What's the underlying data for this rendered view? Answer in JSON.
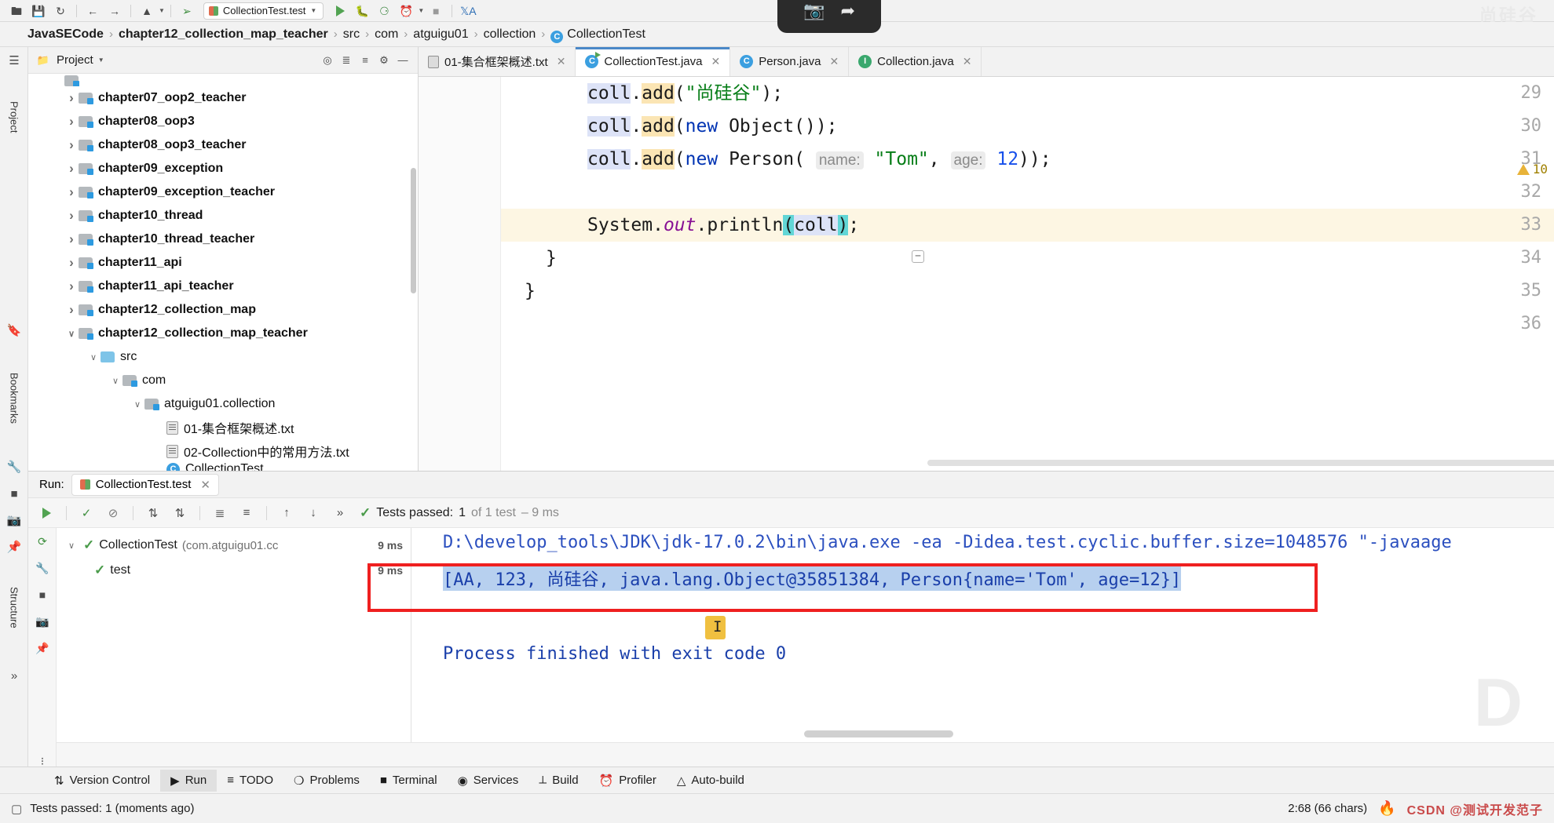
{
  "window": {
    "watermark_top": "尚硅谷",
    "watermark_bottom_brand": "CSDN @测试开发范子",
    "watermark_big": "D"
  },
  "toolbar": {
    "icons": [
      "open-folder-icon",
      "save-icon",
      "sync-icon",
      "back-arrow-icon",
      "forward-arrow-icon",
      "project-structure-icon",
      "build-hammer-icon"
    ],
    "run_config_name": "CollectionTest.test",
    "run_label": "Run",
    "debug_label": "Debug",
    "coverage_label": "Run with Coverage",
    "profile_label": "Profile",
    "stop_label": "Stop",
    "translate_label": "Translate"
  },
  "breadcrumb": {
    "items": [
      {
        "label": "JavaSECode",
        "bold": true,
        "icon": null
      },
      {
        "label": "chapter12_collection_map_teacher",
        "bold": true,
        "icon": null
      },
      {
        "label": "src",
        "bold": false,
        "icon": null
      },
      {
        "label": "com",
        "bold": false,
        "icon": null
      },
      {
        "label": "atguigu01",
        "bold": false,
        "icon": null
      },
      {
        "label": "collection",
        "bold": false,
        "icon": null
      },
      {
        "label": "CollectionTest",
        "bold": false,
        "icon": "java-class-icon"
      }
    ],
    "separator": "›"
  },
  "left_rail": {
    "items": [
      {
        "label": "Project",
        "name": "rail-item-project"
      },
      {
        "label": "Bookmarks",
        "name": "rail-item-bookmarks"
      },
      {
        "label": "Structure",
        "name": "rail-item-structure"
      }
    ]
  },
  "project_panel": {
    "title": "Project",
    "header_icons": [
      "select-opened-file-icon",
      "expand-all-icon",
      "collapse-all-icon",
      "settings-gear-icon",
      "hide-icon"
    ],
    "tree": [
      {
        "label": "chapter07_oop2_teacher",
        "indent": 1,
        "arrow": "closed",
        "icon": "module-folder-icon",
        "bold": true
      },
      {
        "label": "chapter08_oop3",
        "indent": 1,
        "arrow": "closed",
        "icon": "module-folder-icon",
        "bold": true
      },
      {
        "label": "chapter08_oop3_teacher",
        "indent": 1,
        "arrow": "closed",
        "icon": "module-folder-icon",
        "bold": true
      },
      {
        "label": "chapter09_exception",
        "indent": 1,
        "arrow": "closed",
        "icon": "module-folder-icon",
        "bold": true
      },
      {
        "label": "chapter09_exception_teacher",
        "indent": 1,
        "arrow": "closed",
        "icon": "module-folder-icon",
        "bold": true
      },
      {
        "label": "chapter10_thread",
        "indent": 1,
        "arrow": "closed",
        "icon": "module-folder-icon",
        "bold": true
      },
      {
        "label": "chapter10_thread_teacher",
        "indent": 1,
        "arrow": "closed",
        "icon": "module-folder-icon",
        "bold": true
      },
      {
        "label": "chapter11_api",
        "indent": 1,
        "arrow": "closed",
        "icon": "module-folder-icon",
        "bold": true
      },
      {
        "label": "chapter11_api_teacher",
        "indent": 1,
        "arrow": "closed",
        "icon": "module-folder-icon",
        "bold": true
      },
      {
        "label": "chapter12_collection_map",
        "indent": 1,
        "arrow": "closed",
        "icon": "module-folder-icon",
        "bold": true
      },
      {
        "label": "chapter12_collection_map_teacher",
        "indent": 1,
        "arrow": "open",
        "icon": "module-folder-icon",
        "bold": true
      },
      {
        "label": "src",
        "indent": 2,
        "arrow": "open",
        "icon": "source-folder-icon",
        "bold": false
      },
      {
        "label": "com",
        "indent": 3,
        "arrow": "open",
        "icon": "package-folder-icon",
        "bold": false
      },
      {
        "label": "atguigu01.collection",
        "indent": 4,
        "arrow": "open",
        "icon": "package-folder-icon",
        "bold": false
      },
      {
        "label": "01-集合框架概述.txt",
        "indent": 5,
        "arrow": "none",
        "icon": "text-file-icon",
        "bold": false
      },
      {
        "label": "02-Collection中的常用方法.txt",
        "indent": 5,
        "arrow": "none",
        "icon": "text-file-icon",
        "bold": false
      },
      {
        "label": "CollectionTest",
        "indent": 5,
        "arrow": "none",
        "icon": "java-class-icon",
        "bold": false
      }
    ]
  },
  "editor": {
    "tabs": [
      {
        "label": "01-集合框架概述.txt",
        "icon": "text-file-icon",
        "active": false
      },
      {
        "label": "CollectionTest.java",
        "icon": "java-runnable-class-icon",
        "active": true
      },
      {
        "label": "Person.java",
        "icon": "java-class-icon",
        "active": false
      },
      {
        "label": "Collection.java",
        "icon": "java-interface-icon",
        "active": false
      }
    ],
    "warning_count": "10",
    "lines": [
      {
        "number": "29",
        "text": "coll.add(\"尚硅谷\");"
      },
      {
        "number": "30",
        "text": "coll.add(new Object());"
      },
      {
        "number": "31",
        "text": "coll.add(new Person( name: \"Tom\", age: 12));"
      },
      {
        "number": "32",
        "text": ""
      },
      {
        "number": "33",
        "text": "System.out.println(coll);"
      },
      {
        "number": "34",
        "text": "}"
      },
      {
        "number": "35",
        "text": "}"
      },
      {
        "number": "36",
        "text": ""
      }
    ],
    "code": {
      "l29_obj": "coll",
      "l29_dot": ".",
      "l29_m": "add",
      "l29_open": "(",
      "l29_str": "\"尚硅谷\"",
      "l29_close": ");",
      "l30_obj": "coll",
      "l30_m": "add",
      "l30_new": "new",
      "l30_type": "Object());",
      "l31_obj": "coll",
      "l31_m": "add",
      "l31_new": "new",
      "l31_type": "Person(",
      "l31_hint_name": "name:",
      "l31_tom": "\"Tom\"",
      "l31_comma": ",",
      "l31_hint_age": "age:",
      "l31_age": "12",
      "l31_tail": "));",
      "l33_sys": "System",
      "l33_out": "out",
      "l33_pr": "println",
      "l33_arg": "coll",
      "l34_brace": "}",
      "l35_brace": "}"
    }
  },
  "run_panel": {
    "label": "Run:",
    "config_tab": "CollectionTest.test",
    "tests_passed_prefix": "Tests passed:",
    "tests_passed_count": "1",
    "tests_passed_detail": "of 1 test",
    "tests_passed_time": "– 9 ms",
    "toolbar_icons": [
      "rerun-icon",
      "rerun-failed-icon",
      "stop-icon",
      "sort-alpha-icon",
      "sort-duration-icon",
      "expand-all-icon",
      "collapse-all-icon",
      "prev-icon",
      "next-icon",
      "more-icon"
    ],
    "side_icons": [
      "rerun-tests-icon",
      "wrench-settings-icon",
      "stop-icon",
      "camera-icon",
      "pin-icon"
    ],
    "test_tree": [
      {
        "label": "CollectionTest",
        "sub": "(com.atguigu01.cc",
        "ms": "9 ms",
        "indent": 0,
        "status": "pass"
      },
      {
        "label": "test",
        "sub": "",
        "ms": "9 ms",
        "indent": 1,
        "status": "pass"
      }
    ],
    "console": {
      "command_line": "D:\\develop_tools\\JDK\\jdk-17.0.2\\bin\\java.exe -ea -Didea.test.cyclic.buffer.size=1048576 \"-javaage",
      "output_line": "[AA, 123, 尚硅谷, java.lang.Object@35851384, Person{name='Tom', age=12}]",
      "exit_line": "Process finished with exit code 0"
    },
    "highlight_color": "#ef2020"
  },
  "bottom_bar": {
    "items": [
      {
        "label": "Version Control",
        "icon": "branch-icon",
        "active": false
      },
      {
        "label": "Run",
        "icon": "run-triangle-icon",
        "active": true
      },
      {
        "label": "TODO",
        "icon": "list-icon",
        "active": false
      },
      {
        "label": "Problems",
        "icon": "error-circle-icon",
        "active": false
      },
      {
        "label": "Terminal",
        "icon": "terminal-icon",
        "active": false
      },
      {
        "label": "Services",
        "icon": "services-icon",
        "active": false
      },
      {
        "label": "Build",
        "icon": "hammer-icon",
        "active": false
      },
      {
        "label": "Profiler",
        "icon": "profiler-icon",
        "active": false
      },
      {
        "label": "Auto-build",
        "icon": "warning-triangle-icon",
        "active": false
      }
    ]
  },
  "status_bar": {
    "message": "Tests passed: 1 (moments ago)",
    "caret_position": "2:68 (66 chars)"
  }
}
